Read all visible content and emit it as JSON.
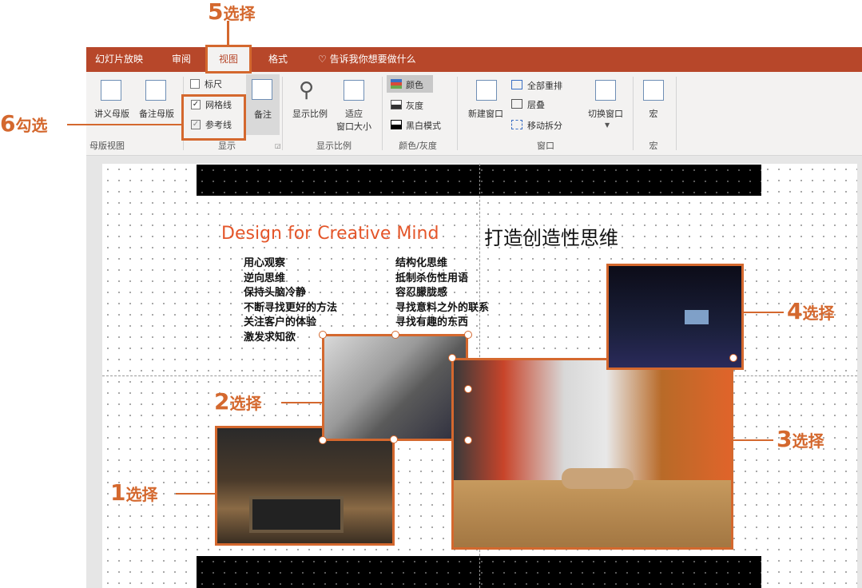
{
  "tabs": {
    "slideshow": "幻灯片放映",
    "review": "审阅",
    "view": "视图",
    "format": "格式",
    "tellme": "告诉我你想要做什么"
  },
  "ribbon": {
    "master_views": {
      "handout_master": "讲义母版",
      "notes_master": "备注母版",
      "group_label": "母版视图"
    },
    "show": {
      "ruler": "标尺",
      "gridlines": "网格线",
      "guides": "参考线",
      "notes": "备注",
      "group_label": "显示",
      "ruler_checked": false,
      "gridlines_checked": true,
      "guides_checked": true
    },
    "zoom": {
      "zoom": "显示比例",
      "fit_line1": "适应",
      "fit_line2": "窗口大小",
      "group_label": "显示比例"
    },
    "color": {
      "color": "颜色",
      "grayscale": "灰度",
      "black_white": "黑白模式",
      "group_label": "颜色/灰度"
    },
    "window": {
      "new_window": "新建窗口",
      "arrange_all": "全部重排",
      "cascade": "层叠",
      "move_split": "移动拆分",
      "switch_windows": "切换窗口",
      "group_label": "窗口"
    },
    "macros": {
      "macros": "宏",
      "group_label": "宏"
    }
  },
  "slide": {
    "heading_en": "Design for Creative Mind",
    "heading_zh": "打造创造性思维",
    "list_left": [
      "用心观察",
      "逆向思维",
      "保持头脑冷静",
      "不断寻找更好的方法",
      "关注客户的体验",
      "激发求知欲"
    ],
    "list_right": [
      "结构化思维",
      "抵制杀伤性用语",
      "容忍朦胧感",
      "寻找意料之外的联系",
      "寻找有趣的东西"
    ]
  },
  "annotations": {
    "a1": {
      "num": "1",
      "text": "选择"
    },
    "a2": {
      "num": "2",
      "text": "选择"
    },
    "a3": {
      "num": "3",
      "text": "选择"
    },
    "a4": {
      "num": "4",
      "text": "选择"
    },
    "a5": {
      "num": "5",
      "text": "选择"
    },
    "a6": {
      "num": "6",
      "text": "勾选"
    }
  },
  "colors": {
    "ribbon_tab_bg": "#b7472a",
    "annotation": "#d4682e",
    "heading_en": "#e4562a"
  }
}
